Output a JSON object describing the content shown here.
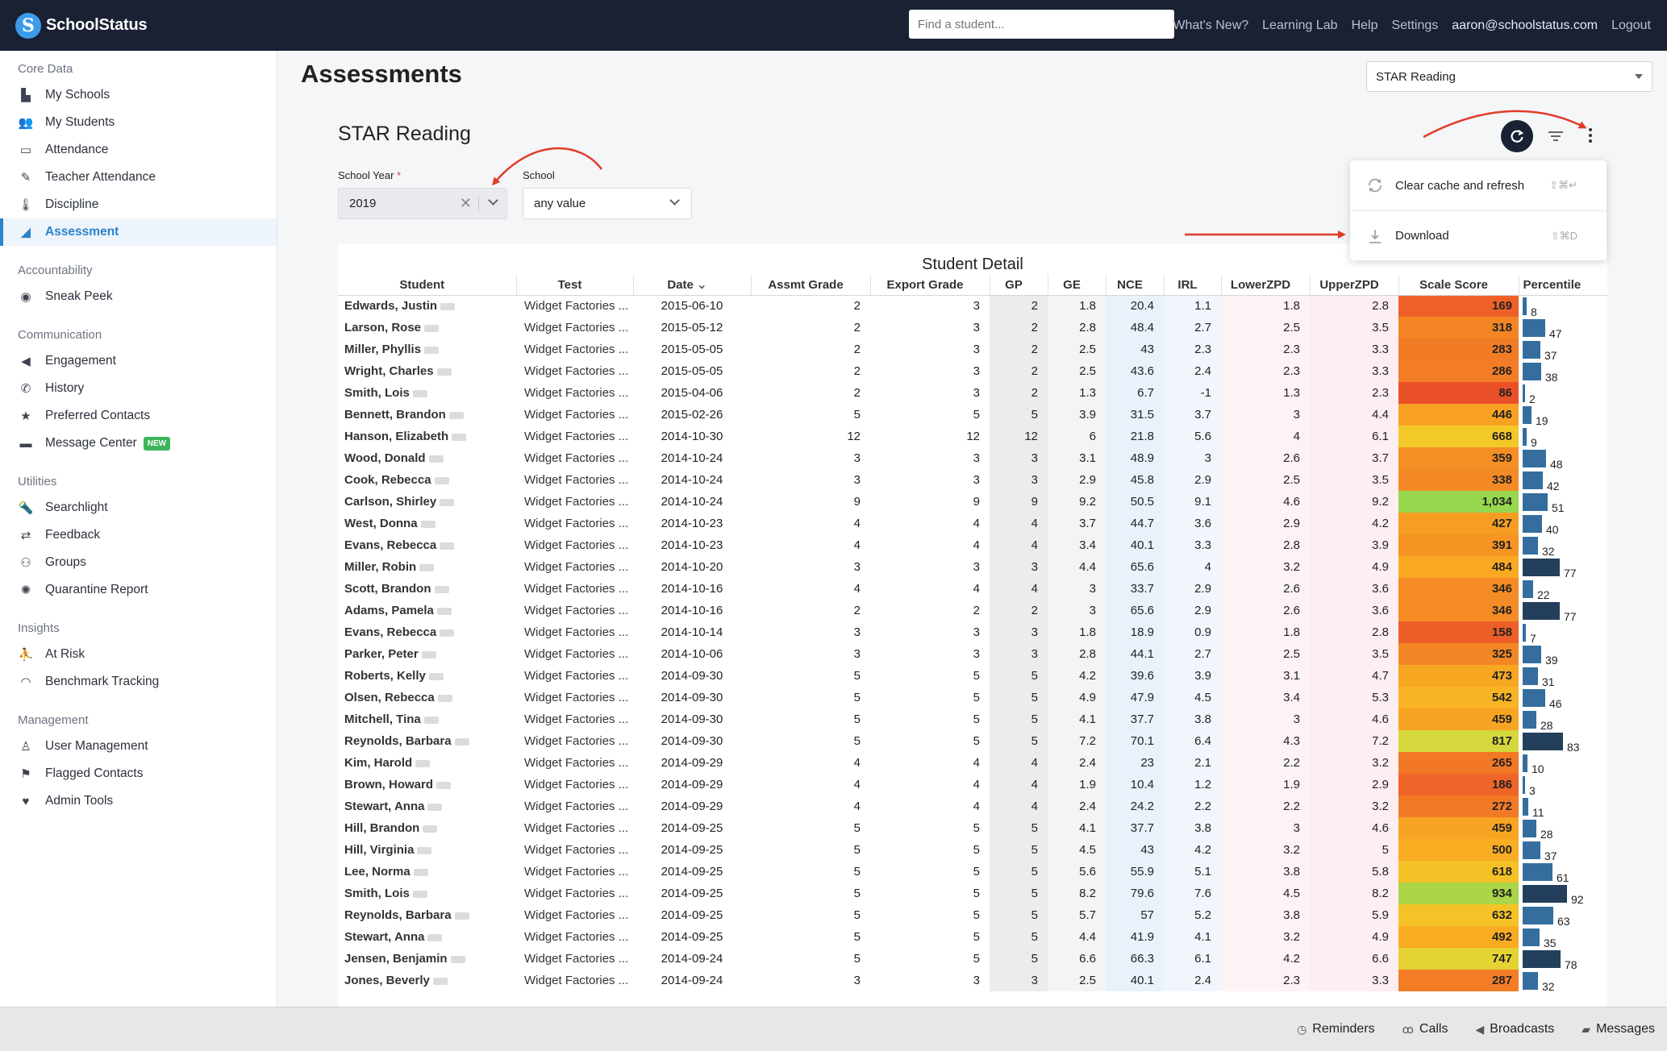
{
  "app": {
    "brand": "SchoolStatus",
    "logo_letter": "S"
  },
  "topbar": {
    "search_placeholder": "Find a student...",
    "links": [
      "What's New?",
      "Learning Lab",
      "Help",
      "Settings"
    ],
    "user_email": "aaron@schoolstatus.com",
    "logout": "Logout"
  },
  "sidebar": {
    "sections": [
      {
        "title": "Core Data",
        "items": [
          {
            "label": "My Schools",
            "icon": "school-icon"
          },
          {
            "label": "My Students",
            "icon": "students-icon"
          },
          {
            "label": "Attendance",
            "icon": "calendar-icon"
          },
          {
            "label": "Teacher Attendance",
            "icon": "pencil-icon"
          },
          {
            "label": "Discipline",
            "icon": "thermometer-icon"
          },
          {
            "label": "Assessment",
            "icon": "area-chart-icon",
            "active": true
          }
        ]
      },
      {
        "title": "Accountability",
        "items": [
          {
            "label": "Sneak Peek",
            "icon": "eye-icon"
          }
        ]
      },
      {
        "title": "Communication",
        "items": [
          {
            "label": "Engagement",
            "icon": "megaphone-icon"
          },
          {
            "label": "History",
            "icon": "phone-icon"
          },
          {
            "label": "Preferred Contacts",
            "icon": "star-icon"
          },
          {
            "label": "Message Center",
            "icon": "envelope-icon",
            "badge": "NEW"
          }
        ]
      },
      {
        "title": "Utilities",
        "items": [
          {
            "label": "Searchlight",
            "icon": "flashlight-icon"
          },
          {
            "label": "Feedback",
            "icon": "retweet-icon"
          },
          {
            "label": "Groups",
            "icon": "group-icon"
          },
          {
            "label": "Quarantine Report",
            "icon": "virus-icon"
          }
        ]
      },
      {
        "title": "Insights",
        "items": [
          {
            "label": "At Risk",
            "icon": "person-risk-icon"
          },
          {
            "label": "Benchmark Tracking",
            "icon": "gauge-icon"
          }
        ]
      },
      {
        "title": "Management",
        "items": [
          {
            "label": "User Management",
            "icon": "person-icon"
          },
          {
            "label": "Flagged Contacts",
            "icon": "user-flag-icon"
          },
          {
            "label": "Admin Tools",
            "icon": "heart-icon"
          }
        ]
      }
    ]
  },
  "main": {
    "page_title": "Assessments",
    "dashboard_select": "STAR Reading",
    "tile_title": "STAR Reading",
    "filters": {
      "year_label": "School Year",
      "year_required": "*",
      "year_value": "2019",
      "school_label": "School",
      "school_value": "any value"
    },
    "menu": [
      {
        "label": "Clear cache and refresh",
        "shortcut": "⇧⌘↵",
        "icon": "sync-icon"
      },
      {
        "label": "Download",
        "shortcut": "⇧⌘D",
        "icon": "download-icon"
      }
    ],
    "table_title": "Student Detail",
    "columns": [
      "Student",
      "Test",
      "Date",
      "Assmt Grade",
      "Export Grade",
      "GP",
      "GE",
      "NCE",
      "IRL",
      "LowerZPD",
      "UpperZPD",
      "Scale Score",
      "Percentile"
    ],
    "rows": [
      [
        "Edwards, Justin",
        "Widget Factories ...",
        "2015-06-10",
        "2",
        "3",
        "2",
        "1.8",
        "20.4",
        "1.1",
        "1.8",
        "2.8",
        "169",
        "8"
      ],
      [
        "Larson, Rose",
        "Widget Factories ...",
        "2015-05-12",
        "2",
        "3",
        "2",
        "2.8",
        "48.4",
        "2.7",
        "2.5",
        "3.5",
        "318",
        "47"
      ],
      [
        "Miller, Phyllis",
        "Widget Factories ...",
        "2015-05-05",
        "2",
        "3",
        "2",
        "2.5",
        "43",
        "2.3",
        "2.3",
        "3.3",
        "283",
        "37"
      ],
      [
        "Wright, Charles",
        "Widget Factories ...",
        "2015-05-05",
        "2",
        "3",
        "2",
        "2.5",
        "43.6",
        "2.4",
        "2.3",
        "3.3",
        "286",
        "38"
      ],
      [
        "Smith, Lois",
        "Widget Factories ...",
        "2015-04-06",
        "2",
        "3",
        "2",
        "1.3",
        "6.7",
        "-1",
        "1.3",
        "2.3",
        "86",
        "2"
      ],
      [
        "Bennett, Brandon",
        "Widget Factories ...",
        "2015-02-26",
        "5",
        "5",
        "5",
        "3.9",
        "31.5",
        "3.7",
        "3",
        "4.4",
        "446",
        "19"
      ],
      [
        "Hanson, Elizabeth",
        "Widget Factories ...",
        "2014-10-30",
        "12",
        "12",
        "12",
        "6",
        "21.8",
        "5.6",
        "4",
        "6.1",
        "668",
        "9"
      ],
      [
        "Wood, Donald",
        "Widget Factories ...",
        "2014-10-24",
        "3",
        "3",
        "3",
        "3.1",
        "48.9",
        "3",
        "2.6",
        "3.7",
        "359",
        "48"
      ],
      [
        "Cook, Rebecca",
        "Widget Factories ...",
        "2014-10-24",
        "3",
        "3",
        "3",
        "2.9",
        "45.8",
        "2.9",
        "2.5",
        "3.5",
        "338",
        "42"
      ],
      [
        "Carlson, Shirley",
        "Widget Factories ...",
        "2014-10-24",
        "9",
        "9",
        "9",
        "9.2",
        "50.5",
        "9.1",
        "4.6",
        "9.2",
        "1,034",
        "51"
      ],
      [
        "West, Donna",
        "Widget Factories ...",
        "2014-10-23",
        "4",
        "4",
        "4",
        "3.7",
        "44.7",
        "3.6",
        "2.9",
        "4.2",
        "427",
        "40"
      ],
      [
        "Evans, Rebecca",
        "Widget Factories ...",
        "2014-10-23",
        "4",
        "4",
        "4",
        "3.4",
        "40.1",
        "3.3",
        "2.8",
        "3.9",
        "391",
        "32"
      ],
      [
        "Miller, Robin",
        "Widget Factories ...",
        "2014-10-20",
        "3",
        "3",
        "3",
        "4.4",
        "65.6",
        "4",
        "3.2",
        "4.9",
        "484",
        "77"
      ],
      [
        "Scott, Brandon",
        "Widget Factories ...",
        "2014-10-16",
        "4",
        "4",
        "4",
        "3",
        "33.7",
        "2.9",
        "2.6",
        "3.6",
        "346",
        "22"
      ],
      [
        "Adams, Pamela",
        "Widget Factories ...",
        "2014-10-16",
        "2",
        "2",
        "2",
        "3",
        "65.6",
        "2.9",
        "2.6",
        "3.6",
        "346",
        "77"
      ],
      [
        "Evans, Rebecca",
        "Widget Factories ...",
        "2014-10-14",
        "3",
        "3",
        "3",
        "1.8",
        "18.9",
        "0.9",
        "1.8",
        "2.8",
        "158",
        "7"
      ],
      [
        "Parker, Peter",
        "Widget Factories ...",
        "2014-10-06",
        "3",
        "3",
        "3",
        "2.8",
        "44.1",
        "2.7",
        "2.5",
        "3.5",
        "325",
        "39"
      ],
      [
        "Roberts, Kelly",
        "Widget Factories ...",
        "2014-09-30",
        "5",
        "5",
        "5",
        "4.2",
        "39.6",
        "3.9",
        "3.1",
        "4.7",
        "473",
        "31"
      ],
      [
        "Olsen, Rebecca",
        "Widget Factories ...",
        "2014-09-30",
        "5",
        "5",
        "5",
        "4.9",
        "47.9",
        "4.5",
        "3.4",
        "5.3",
        "542",
        "46"
      ],
      [
        "Mitchell, Tina",
        "Widget Factories ...",
        "2014-09-30",
        "5",
        "5",
        "5",
        "4.1",
        "37.7",
        "3.8",
        "3",
        "4.6",
        "459",
        "28"
      ],
      [
        "Reynolds, Barbara",
        "Widget Factories ...",
        "2014-09-30",
        "5",
        "5",
        "5",
        "7.2",
        "70.1",
        "6.4",
        "4.3",
        "7.2",
        "817",
        "83"
      ],
      [
        "Kim, Harold",
        "Widget Factories ...",
        "2014-09-29",
        "4",
        "4",
        "4",
        "2.4",
        "23",
        "2.1",
        "2.2",
        "3.2",
        "265",
        "10"
      ],
      [
        "Brown, Howard",
        "Widget Factories ...",
        "2014-09-29",
        "4",
        "4",
        "4",
        "1.9",
        "10.4",
        "1.2",
        "1.9",
        "2.9",
        "186",
        "3"
      ],
      [
        "Stewart, Anna",
        "Widget Factories ...",
        "2014-09-29",
        "4",
        "4",
        "4",
        "2.4",
        "24.2",
        "2.2",
        "2.2",
        "3.2",
        "272",
        "11"
      ],
      [
        "Hill, Brandon",
        "Widget Factories ...",
        "2014-09-25",
        "5",
        "5",
        "5",
        "4.1",
        "37.7",
        "3.8",
        "3",
        "4.6",
        "459",
        "28"
      ],
      [
        "Hill, Virginia",
        "Widget Factories ...",
        "2014-09-25",
        "5",
        "5",
        "5",
        "4.5",
        "43",
        "4.2",
        "3.2",
        "5",
        "500",
        "37"
      ],
      [
        "Lee, Norma",
        "Widget Factories ...",
        "2014-09-25",
        "5",
        "5",
        "5",
        "5.6",
        "55.9",
        "5.1",
        "3.8",
        "5.8",
        "618",
        "61"
      ],
      [
        "Smith, Lois",
        "Widget Factories ...",
        "2014-09-25",
        "5",
        "5",
        "5",
        "8.2",
        "79.6",
        "7.6",
        "4.5",
        "8.2",
        "934",
        "92"
      ],
      [
        "Reynolds, Barbara",
        "Widget Factories ...",
        "2014-09-25",
        "5",
        "5",
        "5",
        "5.7",
        "57",
        "5.2",
        "3.8",
        "5.9",
        "632",
        "63"
      ],
      [
        "Stewart, Anna",
        "Widget Factories ...",
        "2014-09-25",
        "5",
        "5",
        "5",
        "4.4",
        "41.9",
        "4.1",
        "3.2",
        "4.9",
        "492",
        "35"
      ],
      [
        "Jensen, Benjamin",
        "Widget Factories ...",
        "2014-09-24",
        "5",
        "5",
        "5",
        "6.6",
        "66.3",
        "6.1",
        "4.2",
        "6.6",
        "747",
        "78"
      ],
      [
        "Jones, Beverly",
        "Widget Factories ...",
        "2014-09-24",
        "3",
        "3",
        "3",
        "2.5",
        "40.1",
        "2.4",
        "2.3",
        "3.3",
        "287",
        "32"
      ]
    ]
  },
  "bottombar": [
    {
      "label": "Reminders",
      "icon": "clock-icon"
    },
    {
      "label": "Calls",
      "icon": "voicemail-icon"
    },
    {
      "label": "Broadcasts",
      "icon": "megaphone-icon"
    },
    {
      "label": "Messages",
      "icon": "chat-icon"
    }
  ],
  "colors": {
    "topbar": "#192133",
    "accent": "#2b83cc",
    "new_badge": "#3cb55a",
    "percentile_bar": "#356e9e",
    "annotation_arrow": "#e23b2a"
  }
}
